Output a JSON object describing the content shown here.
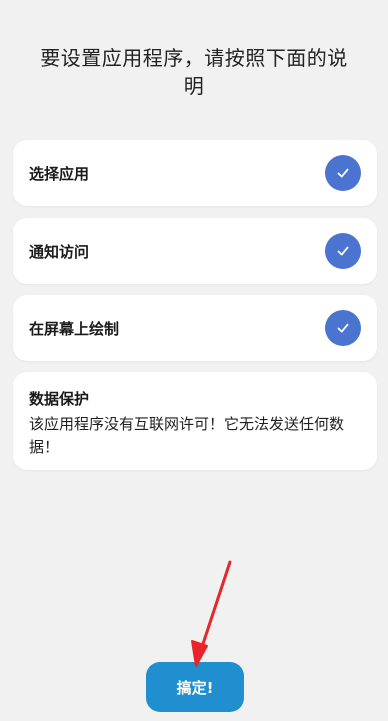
{
  "title": "要设置应用程序，请按照下面的说明",
  "permissions": [
    {
      "label": "选择应用",
      "checked": true
    },
    {
      "label": "通知访问",
      "checked": true
    },
    {
      "label": "在屏幕上绘制",
      "checked": true
    }
  ],
  "data_protection": {
    "title": "数据保护",
    "body": "该应用程序没有互联网许可！它无法发送任何数据！"
  },
  "ok_button_label": "搞定!",
  "colors": {
    "background": "#f1f1f1",
    "check_fill": "#4b74d1",
    "button_fill": "#1f8fd0",
    "arrow": "#e8262a"
  },
  "icons": {
    "check": "checkmark-icon",
    "annotation": "red-arrow-annotation"
  }
}
